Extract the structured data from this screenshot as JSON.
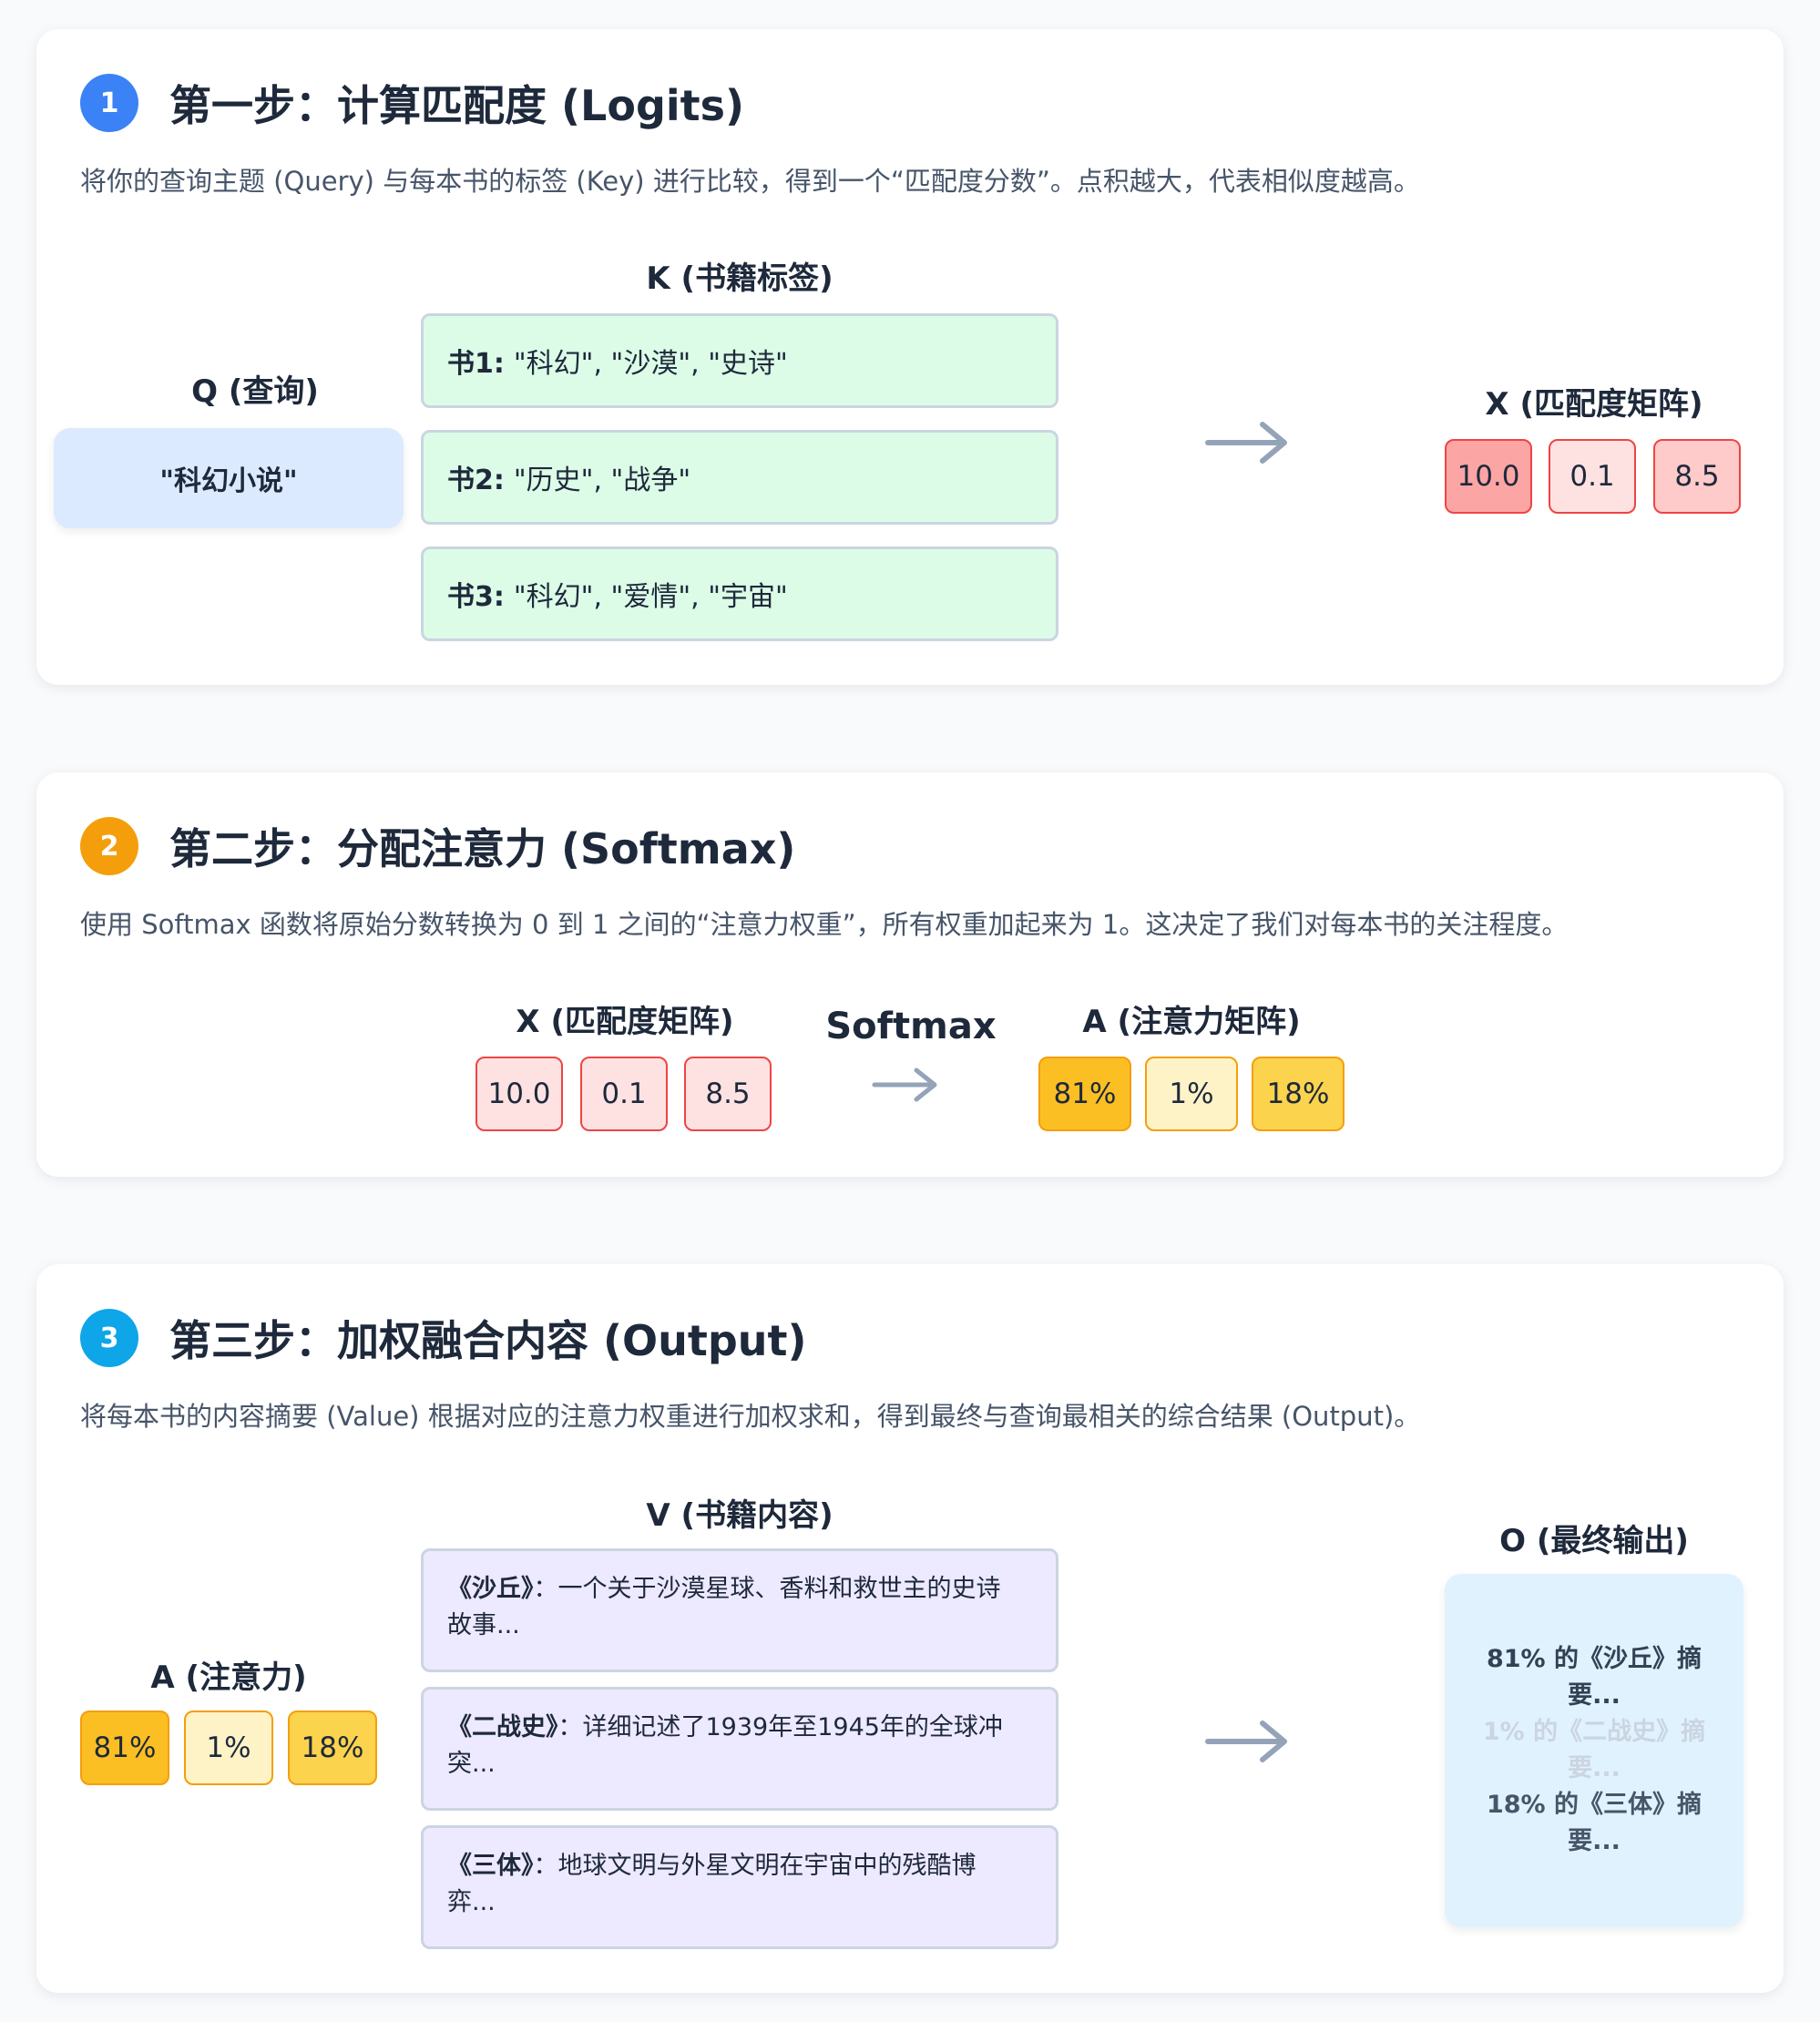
{
  "step1": {
    "number": "1",
    "title": "第一步：计算匹配度 (Logits)",
    "description": "将你的查询主题 (Query) 与每本书的标签 (Key) 进行比较，得到一个“匹配度分数”。点积越大，代表相似度越高。",
    "query_label": "Q (查询)",
    "query_value": "\"科幻小说\"",
    "key_label": "K (书籍标签)",
    "keys": [
      {
        "book": "书1:",
        "tags": "\"科幻\", \"沙漠\", \"史诗\""
      },
      {
        "book": "书2:",
        "tags": "\"历史\", \"战争\""
      },
      {
        "book": "书3:",
        "tags": "\"科幻\", \"爱情\", \"宇宙\""
      }
    ],
    "matrix_label": "X (匹配度矩阵)",
    "logits": [
      "10.0",
      "0.1",
      "8.5"
    ]
  },
  "step2": {
    "number": "2",
    "title": "第二步：分配注意力 (Softmax)",
    "description": "使用 Softmax 函数将原始分数转换为 0 到 1 之间的“注意力权重”，所有权重加起来为 1。这决定了我们对每本书的关注程度。",
    "input_label": "X (匹配度矩阵)",
    "logits": [
      "10.0",
      "0.1",
      "8.5"
    ],
    "operation_label": "Softmax",
    "output_label": "A (注意力矩阵)",
    "weights": [
      "81%",
      "1%",
      "18%"
    ]
  },
  "step3": {
    "number": "3",
    "title": "第三步：加权融合内容 (Output)",
    "description": "将每本书的内容摘要 (Value) 根据对应的注意力权重进行加权求和，得到最终与查询最相关的综合结果 (Output)。",
    "attention_label": "A (注意力)",
    "weights": [
      "81%",
      "1%",
      "18%"
    ],
    "value_label": "V (书籍内容)",
    "values": [
      {
        "title": "《沙丘》",
        "line1": "：一个关于沙漠星球、香料和救世主的史诗",
        "line2": "故事..."
      },
      {
        "title": "《二战史》",
        "line1": "：详细记述了1939年至1945年的全球冲",
        "line2": "突..."
      },
      {
        "title": "《三体》",
        "line1": "：地球文明与外星文明在宇宙中的残酷博",
        "line2": "弈..."
      }
    ],
    "output_label": "O (最终输出)",
    "outputs": [
      {
        "line1": "81% 的《沙丘》摘",
        "line2": "要..."
      },
      {
        "line1": "1% 的《二战史》摘",
        "line2": "要..."
      },
      {
        "line1": "18% 的《三体》摘",
        "line2": "要..."
      }
    ]
  },
  "colors": {
    "badge1": "#3b82f6",
    "badge2": "#f59e0b",
    "badge3": "#0ea5e9",
    "logit_high": "#fca5a5",
    "logit_low": "#fee2e2",
    "weight_high": "#fbbf24",
    "weight_low": "#fef3c7",
    "weight_mid": "#fcd34d",
    "arrow": "#94a3b8"
  }
}
